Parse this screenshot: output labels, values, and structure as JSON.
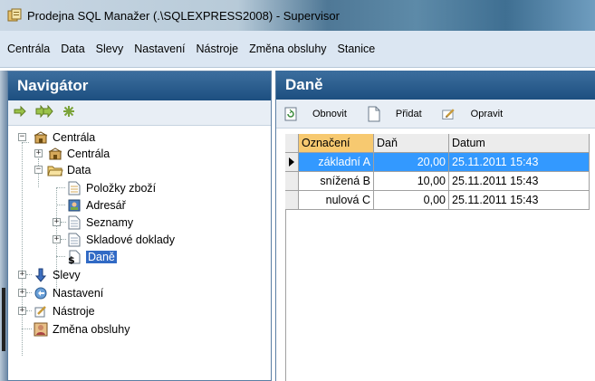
{
  "window": {
    "title": "Prodejna SQL Manažer  (.\\SQLEXPRESS2008) - Supervisor"
  },
  "menu": {
    "items": [
      "Centrála",
      "Data",
      "Slevy",
      "Nastavení",
      "Nástroje",
      "Změna obsluhy",
      "Stanice"
    ]
  },
  "navigator": {
    "title": "Navigátor",
    "tree": {
      "root": "Centrála",
      "centrala": "Centrála",
      "data": "Data",
      "polozky": "Položky zboží",
      "adresar": "Adresář",
      "seznamy": "Seznamy",
      "skladove": "Skladové doklady",
      "dane": "Daně",
      "slevy": "Slevy",
      "nastaveni": "Nastavení",
      "nastroje": "Nástroje",
      "zmena": "Změna obsluhy"
    }
  },
  "panel": {
    "title": "Daně",
    "toolbar": {
      "refresh": "Obnovit",
      "add": "Přidat",
      "edit": "Opravit"
    },
    "grid": {
      "columns": [
        "Označení",
        "Daň",
        "Datum"
      ],
      "rows": [
        {
          "oznaceni": "základní A",
          "dan": "20,00",
          "datum": "25.11.2011 15:43"
        },
        {
          "oznaceni": "snížená B",
          "dan": "10,00",
          "datum": "25.11.2011 15:43"
        },
        {
          "oznaceni": "nulová C",
          "dan": "0,00",
          "datum": "25.11.2011 15:43"
        }
      ]
    }
  },
  "colors": {
    "header_blue": "#1d4f80",
    "selection_blue": "#3399ff",
    "sorted_column": "#f7c970"
  }
}
